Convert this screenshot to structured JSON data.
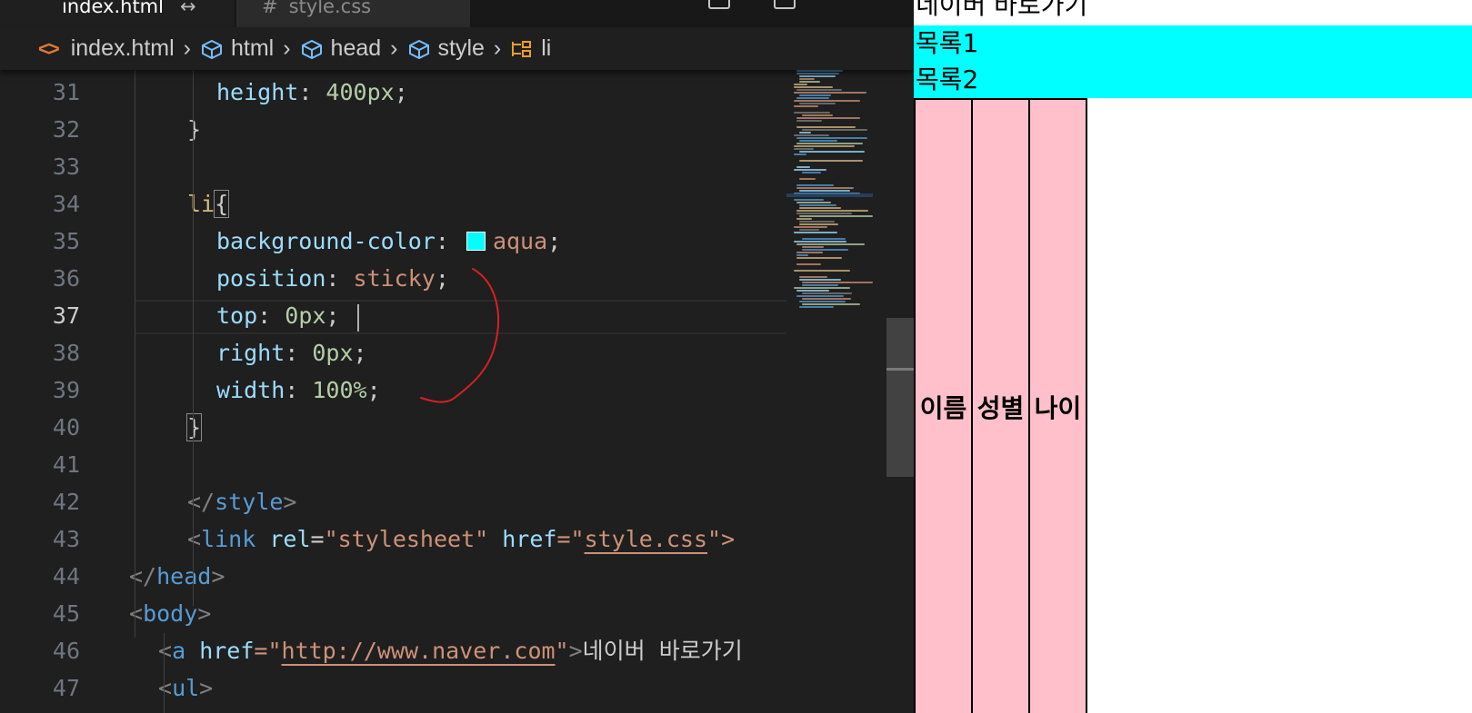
{
  "tabs": [
    {
      "label": "index.html",
      "dirty_mark": "↔",
      "active": true
    },
    {
      "label": "style.css",
      "icon": "#",
      "active": false
    }
  ],
  "breadcrumb": [
    {
      "label": "index.html",
      "icon": "code-icon"
    },
    {
      "label": "html",
      "icon": "cube-icon"
    },
    {
      "label": "head",
      "icon": "cube-icon"
    },
    {
      "label": "style",
      "icon": "cube-icon"
    },
    {
      "label": "li",
      "icon": "selector-icon"
    }
  ],
  "editor": {
    "current_line": 37,
    "lines": [
      {
        "n": "31",
        "tokens": [
          {
            "t": "height",
            "c": "t-prop"
          },
          {
            "t": ": ",
            "c": "t-plain"
          },
          {
            "t": "400px",
            "c": "t-num"
          },
          {
            "t": ";",
            "c": "t-plain"
          }
        ]
      },
      {
        "n": "32",
        "tokens": [
          {
            "t": "}",
            "c": "t-plain"
          }
        ]
      },
      {
        "n": "33",
        "tokens": []
      },
      {
        "n": "34",
        "tokens": [
          {
            "t": "li",
            "c": "t-sel"
          },
          {
            "t": "{",
            "c": "t-plain bracket"
          }
        ]
      },
      {
        "n": "35",
        "tokens": [
          {
            "t": "background-color",
            "c": "t-prop"
          },
          {
            "t": ": ",
            "c": "t-plain"
          },
          {
            "t": "",
            "c": "swatch"
          },
          {
            "t": "aqua",
            "c": "t-str"
          },
          {
            "t": ";",
            "c": "t-plain"
          }
        ]
      },
      {
        "n": "36",
        "tokens": [
          {
            "t": "position",
            "c": "t-prop"
          },
          {
            "t": ": ",
            "c": "t-plain"
          },
          {
            "t": "sticky",
            "c": "t-str"
          },
          {
            "t": ";",
            "c": "t-plain"
          }
        ]
      },
      {
        "n": "37",
        "tokens": [
          {
            "t": "top",
            "c": "t-prop"
          },
          {
            "t": ": ",
            "c": "t-plain"
          },
          {
            "t": "0px",
            "c": "t-num"
          },
          {
            "t": ";",
            "c": "t-plain"
          }
        ]
      },
      {
        "n": "38",
        "tokens": [
          {
            "t": "right",
            "c": "t-prop"
          },
          {
            "t": ": ",
            "c": "t-plain"
          },
          {
            "t": "0px",
            "c": "t-num"
          },
          {
            "t": ";",
            "c": "t-plain"
          }
        ]
      },
      {
        "n": "39",
        "tokens": [
          {
            "t": "width",
            "c": "t-prop"
          },
          {
            "t": ": ",
            "c": "t-plain"
          },
          {
            "t": "100%",
            "c": "t-num"
          },
          {
            "t": ";",
            "c": "t-plain"
          }
        ]
      },
      {
        "n": "40",
        "tokens": [
          {
            "t": "}",
            "c": "t-plain bracket"
          }
        ]
      },
      {
        "n": "41",
        "tokens": []
      },
      {
        "n": "42",
        "tokens": [
          {
            "t": "</",
            "c": "t-punc"
          },
          {
            "t": "style",
            "c": "t-tag"
          },
          {
            "t": ">",
            "c": "t-punc"
          }
        ]
      },
      {
        "n": "43",
        "tokens": [
          {
            "t": "<",
            "c": "t-punc"
          },
          {
            "t": "link",
            "c": "t-tag"
          },
          {
            "t": " ",
            "c": "t-plain"
          },
          {
            "t": "rel",
            "c": "t-attr"
          },
          {
            "t": "=",
            "c": "t-plain"
          },
          {
            "t": "\"stylesheet\"",
            "c": "t-str"
          },
          {
            "t": " ",
            "c": "t-plain"
          },
          {
            "t": "href",
            "c": "t-attr"
          },
          {
            "t": "=\"",
            "c": "t-str"
          },
          {
            "t": "style.css",
            "c": "t-link"
          },
          {
            "t": "\">",
            "c": "t-str"
          }
        ]
      },
      {
        "n": "44",
        "tokens": [
          {
            "t": "</",
            "c": "t-punc"
          },
          {
            "t": "head",
            "c": "t-tag"
          },
          {
            "t": ">",
            "c": "t-punc"
          }
        ]
      },
      {
        "n": "45",
        "tokens": [
          {
            "t": "<",
            "c": "t-punc"
          },
          {
            "t": "body",
            "c": "t-tag"
          },
          {
            "t": ">",
            "c": "t-punc"
          }
        ]
      },
      {
        "n": "46",
        "tokens": [
          {
            "t": "<",
            "c": "t-punc"
          },
          {
            "t": "a",
            "c": "t-tag"
          },
          {
            "t": " ",
            "c": "t-plain"
          },
          {
            "t": "href",
            "c": "t-attr"
          },
          {
            "t": "=\"",
            "c": "t-str"
          },
          {
            "t": "http://www.naver.com",
            "c": "t-link"
          },
          {
            "t": "\"",
            "c": "t-str"
          },
          {
            "t": ">",
            "c": "t-punc"
          },
          {
            "t": "네이버 바로가기",
            "c": "t-plain"
          }
        ]
      },
      {
        "n": "47",
        "tokens": [
          {
            "t": "<",
            "c": "t-punc"
          },
          {
            "t": "ul",
            "c": "t-tag"
          },
          {
            "t": ">",
            "c": "t-punc"
          }
        ]
      }
    ]
  },
  "preview": {
    "link_text": "네이버 바로가기",
    "list_items": [
      "목록1",
      "목록2"
    ],
    "table_headers": [
      "이름",
      "성별",
      "나이"
    ],
    "colors": {
      "li_background": "#00ffff",
      "cell_background": "#ffc0cb"
    }
  },
  "colors": {
    "editor_bg": "#1f1f1f",
    "annotation": "#d92020"
  }
}
